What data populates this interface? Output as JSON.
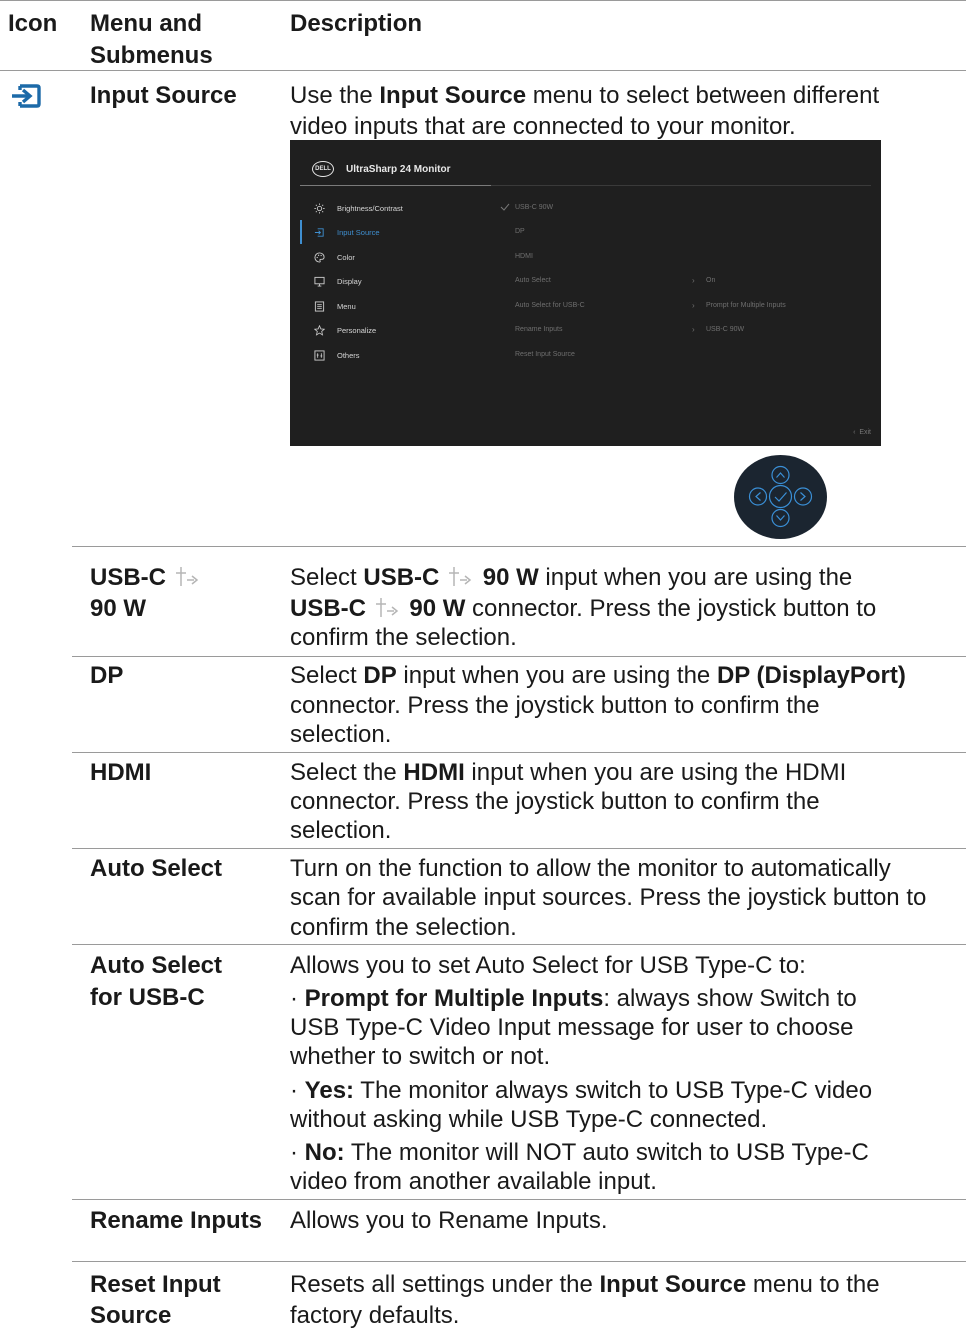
{
  "header": {
    "col1": "Icon",
    "col2_line1": "Menu and",
    "col2_line2": "Submenus",
    "col3": "Description"
  },
  "input_source": {
    "name": "Input Source",
    "desc_pre": "Use the ",
    "desc_bold": "Input Source",
    "desc_post_line1": " menu to select between different",
    "desc_line2": "video inputs that are connected to your monitor."
  },
  "osd": {
    "logo": "DELL",
    "title": "UltraSharp 24 Monitor",
    "menu": [
      "Brightness/Contrast",
      "Input Source",
      "Color",
      "Display",
      "Menu",
      "Personalize",
      "Others"
    ],
    "options": [
      "USB-C 90W",
      "DP",
      "HDMI",
      "Auto Select",
      "Auto Select for USB-C",
      "Rename Inputs",
      "Reset Input Source"
    ],
    "values": {
      "auto_select": "On",
      "auto_select_usbc": "Prompt for Multiple Inputs",
      "rename": "USB-C 90W"
    },
    "exit": "Exit",
    "accent_color": "#3f8fd0"
  },
  "rows": {
    "usbc": {
      "name1": "USB-C",
      "name2": "90 W",
      "l1_a": "Select ",
      "l1_b": "USB-C",
      "l1_c": "90 W",
      "l1_d": " input when you are using the",
      "l2_a": "USB-C",
      "l2_b": "90 W",
      "l2_c": " connector. Press the joystick button to",
      "l3": "confirm the selection."
    },
    "dp": {
      "name": "DP",
      "l1_a": "Select ",
      "l1_b": "DP",
      "l1_c": " input when you are using the ",
      "l1_d": "DP (DisplayPort)",
      "l2": "connector. Press the joystick button to confirm the",
      "l3": "selection."
    },
    "hdmi": {
      "name": "HDMI",
      "l1_a": "Select the ",
      "l1_b": "HDMI",
      "l1_c": " input when you are using the HDMI",
      "l2": "connector. Press the joystick button to confirm the",
      "l3": "selection."
    },
    "auto": {
      "name": "Auto Select",
      "l1": "Turn on the function to allow the monitor to automatically",
      "l2": "scan for available input sources. Press the joystick button to",
      "l3": "confirm the selection."
    },
    "auto_usbc": {
      "name1": "Auto Select",
      "name2": "for USB-C",
      "intro": "Allows you to set Auto Select for USB Type-C to:",
      "p_bullet": "· ",
      "p_bold": "Prompt for Multiple Inputs",
      "p_l1": ": always show Switch to",
      "p_l2": "USB Type-C Video Input message for user to choose",
      "p_l3": "whether to switch or not.",
      "y_bold": "Yes:",
      "y_l1": " The monitor always switch to USB Type-C video",
      "y_l2": "without asking while USB Type-C connected.",
      "n_bold": "No:",
      "n_l1": " The monitor will NOT auto switch to USB Type-C",
      "n_l2": "video from another available input."
    },
    "rename": {
      "name": "Rename Inputs",
      "desc": "Allows you to Rename Inputs."
    },
    "reset": {
      "name1": "Reset Input",
      "name2": "Source",
      "l1_a": "Resets all settings under the ",
      "l1_b": "Input Source",
      "l1_c": " menu to the",
      "l2": "factory defaults."
    }
  }
}
